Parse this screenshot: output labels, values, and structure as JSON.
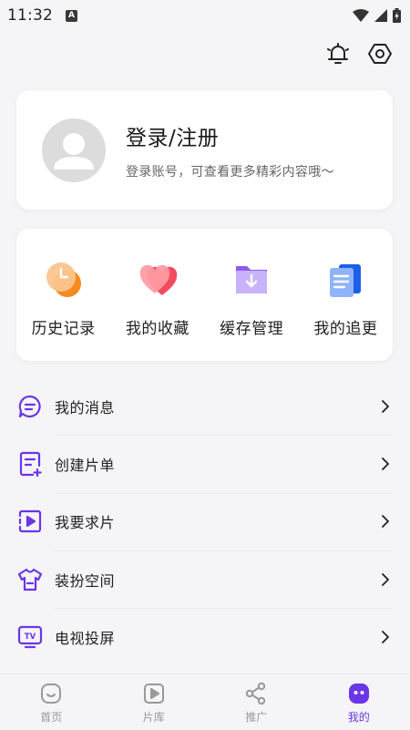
{
  "status_bar": {
    "time": "11:32",
    "notification_glyph": "A"
  },
  "profile": {
    "title": "登录/注册",
    "subtitle": "登录账号，可查看更多精彩内容哦～"
  },
  "shortcuts": [
    {
      "label": "历史记录",
      "icon": "history-clock-icon"
    },
    {
      "label": "我的收藏",
      "icon": "heart-favorites-icon"
    },
    {
      "label": "缓存管理",
      "icon": "download-folder-icon"
    },
    {
      "label": "我的追更",
      "icon": "document-follow-icon"
    }
  ],
  "menu": [
    {
      "label": "我的消息",
      "icon": "message-bubble-icon"
    },
    {
      "label": "创建片单",
      "icon": "create-list-icon"
    },
    {
      "label": "我要求片",
      "icon": "request-video-icon"
    },
    {
      "label": "装扮空间",
      "icon": "tshirt-icon"
    },
    {
      "label": "电视投屏",
      "icon": "tv-cast-icon"
    }
  ],
  "bottom_nav": [
    {
      "label": "首页",
      "icon": "home-face-icon",
      "active": false
    },
    {
      "label": "片库",
      "icon": "video-library-icon",
      "active": false
    },
    {
      "label": "推广",
      "icon": "share-icon",
      "active": false
    },
    {
      "label": "我的",
      "icon": "profile-mascot-icon",
      "active": true
    }
  ],
  "colors": {
    "accent": "#6b35e8",
    "inactive": "#999999",
    "background": "#f5f5f7"
  }
}
